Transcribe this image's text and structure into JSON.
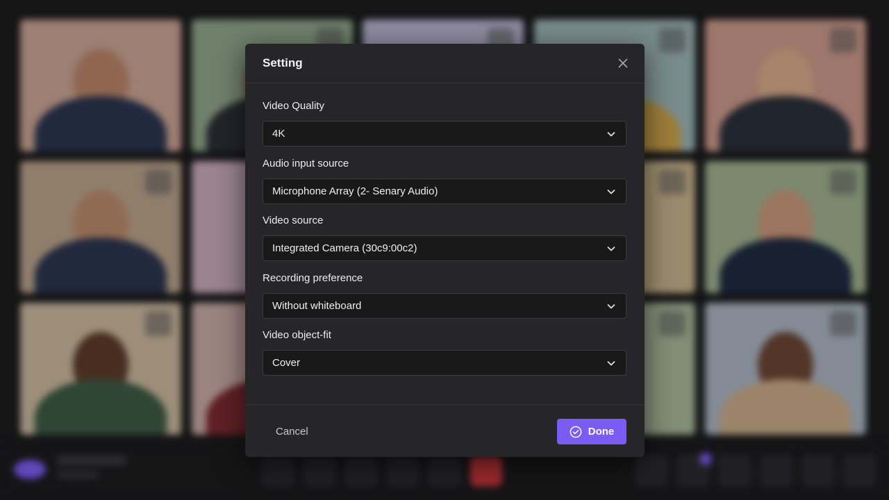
{
  "dialog": {
    "title": "Setting",
    "fields": [
      {
        "label": "Video Quality",
        "value": "4K"
      },
      {
        "label": "Audio input source",
        "value": "Microphone Array (2- Senary Audio)"
      },
      {
        "label": "Video source",
        "value": "Integrated Camera (30c9:00c2)"
      },
      {
        "label": "Recording preference",
        "value": "Without whiteboard"
      },
      {
        "label": "Video object-fit",
        "value": "Cover"
      }
    ],
    "cancel_label": "Cancel",
    "done_label": "Done"
  },
  "icons": {
    "close": "close-icon",
    "chevron": "chevron-down-icon",
    "done": "check-circle-icon"
  },
  "colors": {
    "accent": "#7b5cf3",
    "modal_bg": "#262628",
    "select_bg": "#19191a",
    "leave_red": "#c9373b"
  }
}
